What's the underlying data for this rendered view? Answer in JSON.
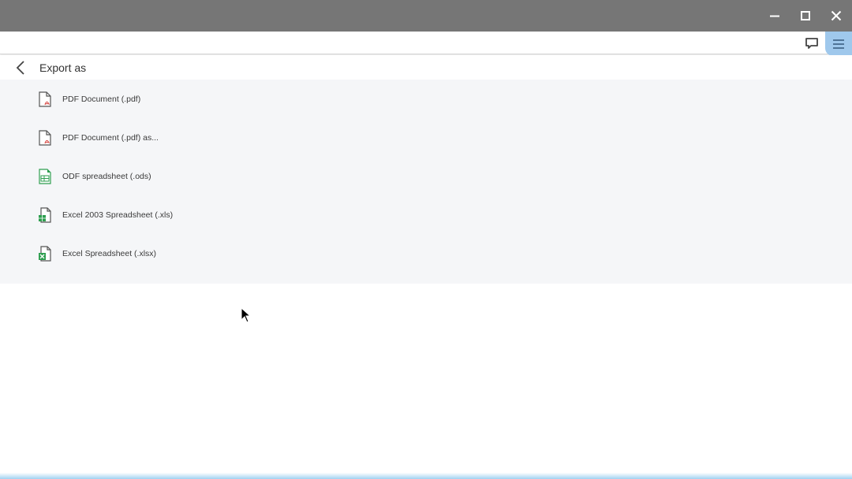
{
  "window": {
    "controls": [
      "minimize-icon",
      "maximize-icon",
      "close-icon"
    ]
  },
  "toolbar": {
    "comment_icon": "comment-icon",
    "menu_icon": "hamburger-menu-icon",
    "menu_accent": "#9fc8ec"
  },
  "header": {
    "back_icon": "chevron-left-icon",
    "title": "Export as"
  },
  "export_options": [
    {
      "label": "PDF Document (.pdf)",
      "icon": "pdf-file-icon"
    },
    {
      "label": "PDF Document (.pdf) as...",
      "icon": "pdf-file-icon"
    },
    {
      "label": "ODF spreadsheet (.ods)",
      "icon": "ods-file-icon"
    },
    {
      "label": "Excel 2003 Spreadsheet (.xls)",
      "icon": "xls-file-icon"
    },
    {
      "label": "Excel Spreadsheet (.xlsx)",
      "icon": "xlsx-file-icon"
    }
  ],
  "colors": {
    "titlebar": "#767676",
    "panel": "#f5f6f8",
    "pdf_red": "#d9534f",
    "sheet_green": "#2e9e4f"
  }
}
